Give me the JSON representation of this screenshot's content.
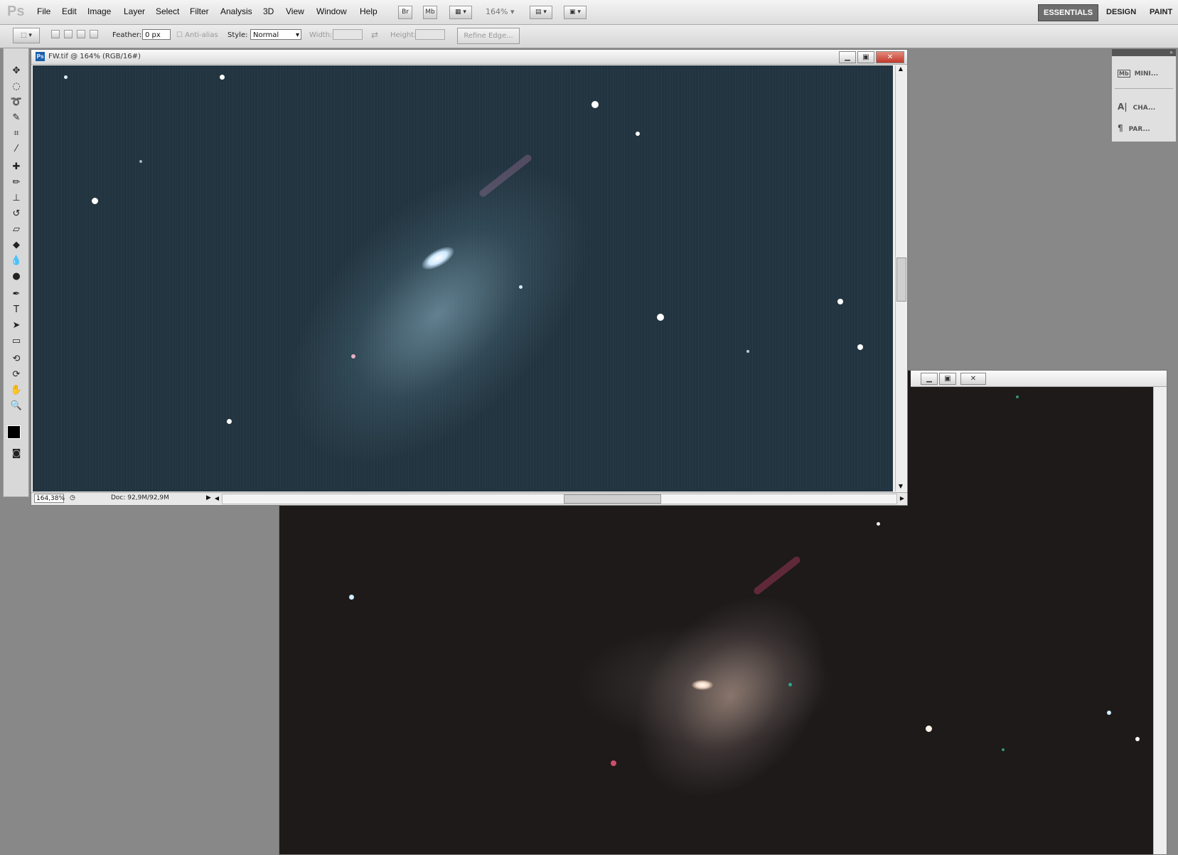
{
  "app": {
    "logo": "Ps"
  },
  "menu": [
    "File",
    "Edit",
    "Image",
    "Layer",
    "Select",
    "Filter",
    "Analysis",
    "3D",
    "View",
    "Window",
    "Help"
  ],
  "appbar": {
    "bridge": "Br",
    "minibridge": "Mb",
    "zoom": "164%"
  },
  "workspaces": [
    "ESSENTIALS",
    "DESIGN",
    "PAINT"
  ],
  "options": {
    "feather_label": "Feather:",
    "feather_value": "0 px",
    "antialias_label": "Anti-alias",
    "style_label": "Style:",
    "style_value": "Normal",
    "width_label": "Width:",
    "height_label": "Height:",
    "refine_edge": "Refine Edge..."
  },
  "doc1": {
    "title": "FW.tif @ 164% (RGB/16#)",
    "zoom_field": "164,38%",
    "doc_info": "Doc: 92,9M/92,9M"
  },
  "panel": {
    "items": [
      "MINI...",
      "CHA...",
      "PAR..."
    ]
  },
  "colors": {
    "doc1_bg": "#22343f",
    "doc2_bg": "#1d1a19",
    "accent": "#1b5fa8"
  }
}
